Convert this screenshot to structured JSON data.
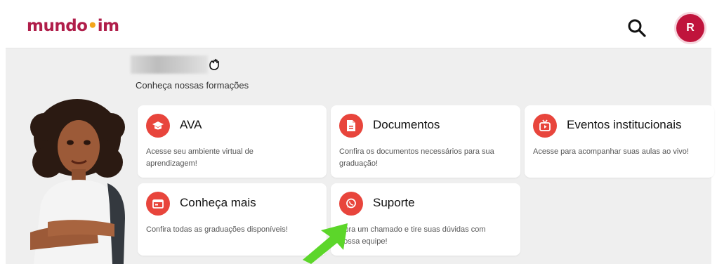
{
  "header": {
    "logo_main": "mundo",
    "logo_tail": "im",
    "avatar_initial": "R"
  },
  "intro": {
    "subtitle": "Conheça nossas formações"
  },
  "cards": [
    {
      "title": "AVA",
      "desc": "Acesse seu ambiente virtual de aprendizagem!",
      "icon": "graduation-cap-icon"
    },
    {
      "title": "Documentos",
      "desc": "Confira os documentos necessários para sua graduação!",
      "icon": "document-icon"
    },
    {
      "title": "Eventos institucionais",
      "desc": "Acesse para acompanhar suas aulas ao vivo!",
      "icon": "live-tv-icon"
    },
    {
      "title": "Conheça mais",
      "desc": "Confira todas as graduações disponíveis!",
      "icon": "catalog-icon"
    },
    {
      "title": "Suporte",
      "desc": "Abra um chamado e tire suas dúvidas com nossa equipe!",
      "icon": "whatsapp-icon"
    }
  ],
  "colors": {
    "accent": "#e8453c",
    "brand": "#b01e4a",
    "brand_dot": "#f3a51b",
    "avatar_bg": "#c0143c",
    "arrow": "#5cd62a"
  }
}
